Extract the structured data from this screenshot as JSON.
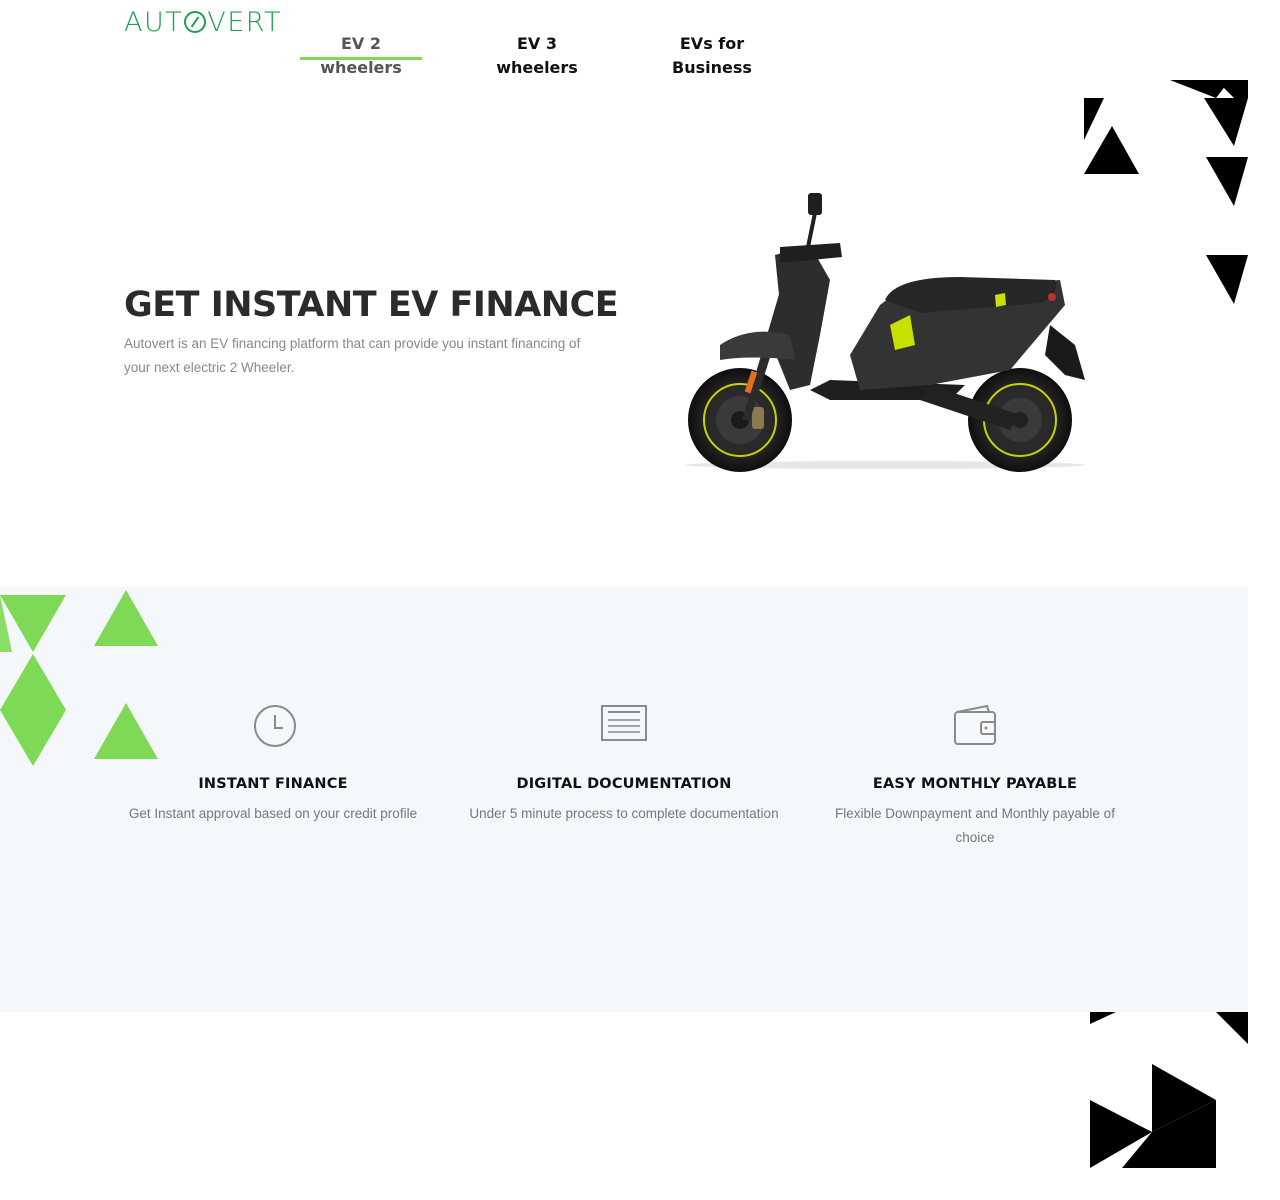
{
  "brand": {
    "logo_text_a": "AUT",
    "logo_text_b": "VERT",
    "accent": "#7ed957",
    "logo_color": "#1aa34a"
  },
  "nav": [
    {
      "label": "EV 2 wheelers",
      "active": true
    },
    {
      "label": "EV 3 wheelers",
      "active": false
    },
    {
      "label": "EVs for Business",
      "active": false
    }
  ],
  "hero": {
    "title": "GET INSTANT EV FINANCE",
    "description": "Autovert is an EV financing platform that can provide you instant financing of your next electric 2 Wheeler.",
    "image": "electric-scooter-image"
  },
  "features": [
    {
      "icon": "clock-icon",
      "title": "INSTANT FINANCE",
      "description": "Get Instant approval based on your credit profile"
    },
    {
      "icon": "document-icon",
      "title": "DIGITAL DOCUMENTATION",
      "description": "Under 5 minute process to complete documentation"
    },
    {
      "icon": "wallet-icon",
      "title": "EASY MONTHLY PAYABLE",
      "description": "Flexible Downpayment and Monthly payable of choice"
    }
  ],
  "colors": {
    "feature_band_bg": "#f5f8fa",
    "deco_green": "#7ed957",
    "deco_black": "#000000"
  }
}
